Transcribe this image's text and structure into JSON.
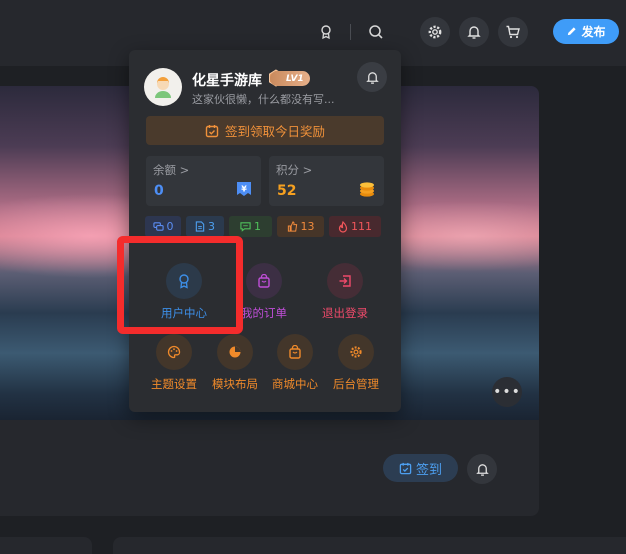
{
  "topbar": {
    "icons": [
      "award-icon",
      "search-icon",
      "settings-icon",
      "bell-icon",
      "cart-icon"
    ],
    "publish_label": "发布"
  },
  "banner": {
    "more_label": "•••"
  },
  "infobar": {
    "sign_label": "签到"
  },
  "user_panel": {
    "username": "化星手游库",
    "level_badge": "LV1",
    "bio": "这家伙很懒，什么都没有写...",
    "checkin_label": "签到领取今日奖励",
    "balance": {
      "label": "余额",
      "chevron": ">",
      "value": "0",
      "color": "#4d8ef5"
    },
    "points": {
      "label": "积分",
      "chevron": ">",
      "value": "52",
      "color": "#f5a020"
    },
    "counts": [
      {
        "name": "comments",
        "icon": "chat-icon",
        "value": "0",
        "color": "#5a8cf2",
        "bg": "#2d3650"
      },
      {
        "name": "posts",
        "icon": "doc-icon",
        "value": "3",
        "color": "#4d9ff0",
        "bg": "#2b3a4e"
      },
      {
        "name": "messages",
        "icon": "message-icon",
        "value": "1",
        "color": "#4fbf5a",
        "bg": "#2d3e30"
      },
      {
        "name": "likes",
        "icon": "thumb-icon",
        "value": "13",
        "color": "#f08a3c",
        "bg": "#463528"
      },
      {
        "name": "hot",
        "icon": "fire-icon",
        "value": "111",
        "color": "#f0565a",
        "bg": "#48292e"
      }
    ],
    "menu_row1": [
      {
        "label": "用户中心",
        "color": "#3d8fe8",
        "bg": "#2c3a4a"
      },
      {
        "label": "我的订单",
        "color": "#c04ed8",
        "bg": "#3c2f44"
      },
      {
        "label": "退出登录",
        "color": "#ee4a6a",
        "bg": "#452d36"
      }
    ],
    "menu_row2": [
      {
        "label": "主题设置",
        "color": "#f08a2a",
        "bg": "#43362a"
      },
      {
        "label": "模块布局",
        "color": "#f08a2a",
        "bg": "#43362a"
      },
      {
        "label": "商城中心",
        "color": "#f08a2a",
        "bg": "#43362a"
      },
      {
        "label": "后台管理",
        "color": "#f08a2a",
        "bg": "#43362a"
      }
    ]
  }
}
